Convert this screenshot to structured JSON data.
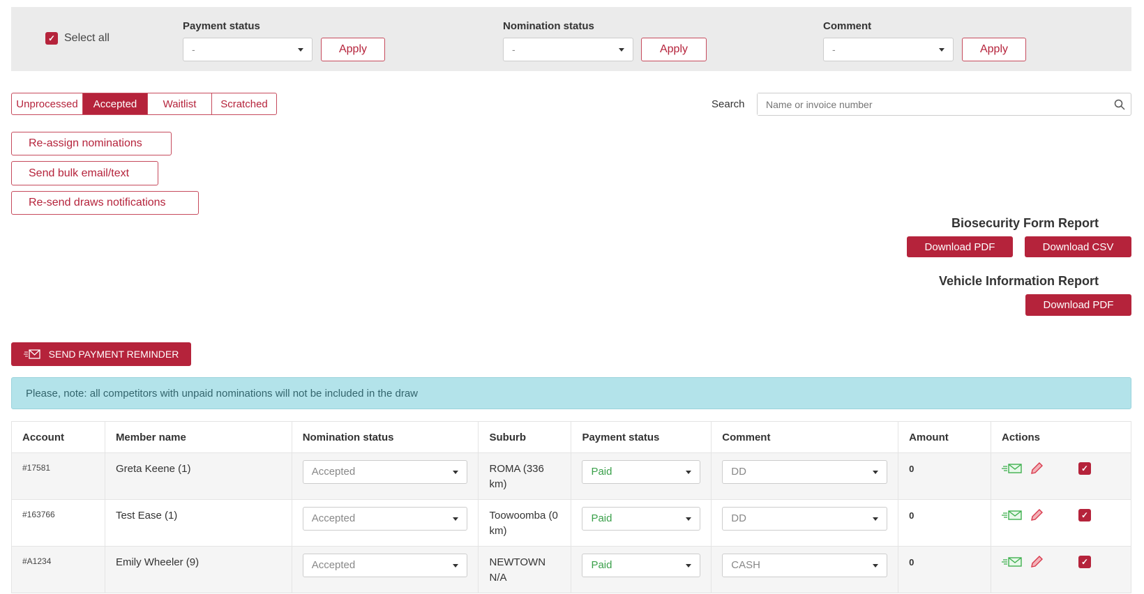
{
  "filters": {
    "select_all": "Select all",
    "groups": [
      {
        "label": "Payment status",
        "value": "-",
        "apply": "Apply"
      },
      {
        "label": "Nomination status",
        "value": "-",
        "apply": "Apply"
      },
      {
        "label": "Comment",
        "value": "-",
        "apply": "Apply"
      }
    ]
  },
  "tabs": [
    "Unprocessed",
    "Accepted",
    "Waitlist",
    "Scratched"
  ],
  "active_tab": "Accepted",
  "search": {
    "label": "Search",
    "placeholder": "Name or invoice number"
  },
  "actions": [
    "Re-assign nominations",
    "Send bulk email/text",
    "Re-send draws notifications"
  ],
  "reports": {
    "biosecurity": {
      "title": "Biosecurity Form Report",
      "pdf": "Download PDF",
      "csv": "Download CSV"
    },
    "vehicle": {
      "title": "Vehicle Information Report",
      "pdf": "Download PDF"
    }
  },
  "reminder_button": "SEND PAYMENT REMINDER",
  "alert": "Please, note: all competitors with unpaid nominations will not be included in the draw",
  "table": {
    "headers": [
      "Account",
      "Member name",
      "Nomination status",
      "Suburb",
      "Payment status",
      "Comment",
      "Amount",
      "Actions"
    ],
    "rows": [
      {
        "account": "#17581",
        "name": "Greta Keene (1)",
        "nomination": "Accepted",
        "suburb": "ROMA (336 km)",
        "payment": "Paid",
        "comment": "DD",
        "amount": "0"
      },
      {
        "account": "#163766",
        "name": "Test Ease (1)",
        "nomination": "Accepted",
        "suburb": "Toowoomba (0 km)",
        "payment": "Paid",
        "comment": "DD",
        "amount": "0"
      },
      {
        "account": "#A1234",
        "name": "Emily Wheeler (9)",
        "nomination": "Accepted",
        "suburb": "NEWTOWN N/A",
        "payment": "Paid",
        "comment": "CASH",
        "amount": "0"
      }
    ]
  },
  "colors": {
    "accent": "#b5233b",
    "paid": "#3aa04a",
    "alert_bg": "#b3e3ea"
  }
}
